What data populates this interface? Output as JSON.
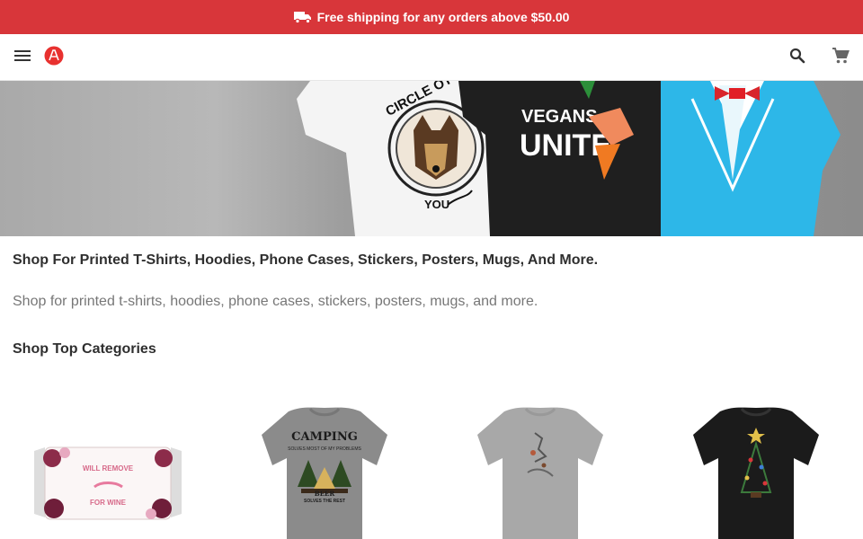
{
  "promo": {
    "icon": "truck-icon",
    "text": "Free shipping for any orders above $50.00",
    "color": "#d8363a"
  },
  "header": {
    "menu_icon": "menu-icon",
    "logo_icon": "brand-logo-icon",
    "search_icon": "search-icon",
    "cart_icon": "cart-icon",
    "brand_color": "#e8312f"
  },
  "hero": {
    "shirt1_text_top": "CIRCLE OT TRU",
    "shirt1_text_bottom": "YOU",
    "shirt2_line1": "VEGANS",
    "shirt2_line2": "UNITE"
  },
  "main": {
    "headline": "Shop For Printed T-Shirts, Hoodies, Phone Cases, Stickers, Posters, Mugs, And More.",
    "subtext": "Shop for printed t-shirts, hoodies, phone cases, stickers, posters, mugs, and more.",
    "section_title": "Shop Top Categories"
  },
  "products": [
    {
      "type": "face-mask",
      "line1": "WILL REMOVE",
      "line2": "FOR WINE"
    },
    {
      "type": "t-shirt",
      "line1": "CAMPING",
      "line2": "SOLVES MOST OF MY PROBLEMS",
      "line3": "BEER",
      "line4": "SOLVES THE REST"
    },
    {
      "type": "t-shirt"
    },
    {
      "type": "t-shirt"
    }
  ]
}
